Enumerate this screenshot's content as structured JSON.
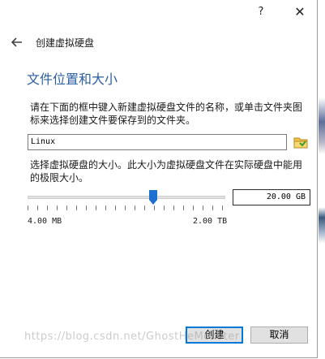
{
  "titlebar": {
    "help": "?",
    "close": "✕"
  },
  "wizard": {
    "title": "创建虚拟硬盘"
  },
  "page": {
    "heading": "文件位置和大小",
    "description": "请在下面的框中键入新建虚拟硬盘文件的名称，或单击文件夹图标来选择创建文件要保存到的文件夹。",
    "file_name": "Linux",
    "size_description": "选择虚拟硬盘的大小。此大小为虚拟硬盘文件在实际硬盘中能用的极限大小。",
    "size_value": "20.00 GB",
    "min_label": "4.00 MB",
    "max_label": "2.00 TB"
  },
  "slider": {
    "position_fraction": 0.64
  },
  "buttons": {
    "create": "创建",
    "cancel": "取消"
  },
  "watermark": "https://blog.csdn.net/GhostHeMonster",
  "colors": {
    "heading": "#2b5fa0",
    "accent": "#0078d7",
    "thumb": "#1e6fd0"
  }
}
